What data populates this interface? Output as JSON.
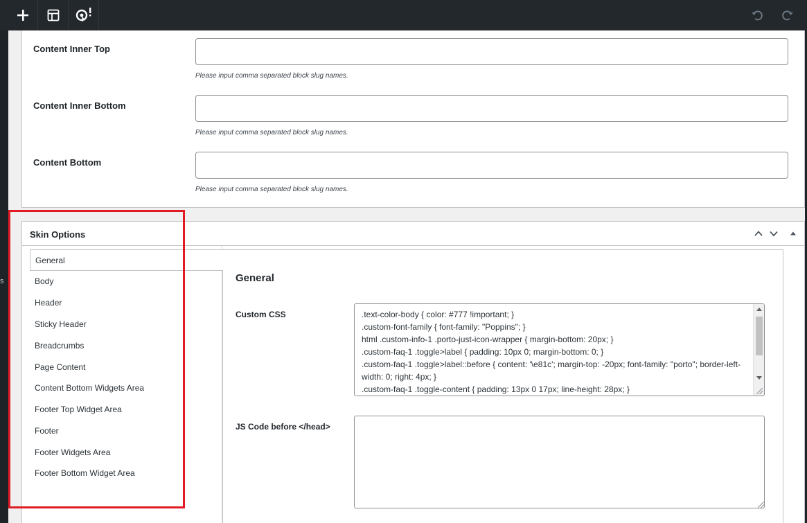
{
  "toolbar": {
    "add_icon": "plus-icon",
    "layout_icon": "layout-icon",
    "insights_icon": "insights-alert-icon",
    "undo_icon": "undo-icon",
    "redo_icon": "redo-icon"
  },
  "left_strip": {
    "glyph": "s"
  },
  "content_fields": [
    {
      "label": "Content Inner Top",
      "value": "",
      "description": "Please input comma separated block slug names."
    },
    {
      "label": "Content Inner Bottom",
      "value": "",
      "description": "Please input comma separated block slug names."
    },
    {
      "label": "Content Bottom",
      "value": "",
      "description": "Please input comma separated block slug names."
    }
  ],
  "skin_options": {
    "title": "Skin Options",
    "tabs": [
      {
        "label": "General",
        "active": true
      },
      {
        "label": "Body"
      },
      {
        "label": "Header"
      },
      {
        "label": "Sticky Header"
      },
      {
        "label": "Breadcrumbs"
      },
      {
        "label": "Page Content"
      },
      {
        "label": "Content Bottom Widgets Area"
      },
      {
        "label": "Footer Top Widget Area"
      },
      {
        "label": "Footer"
      },
      {
        "label": "Footer Widgets Area"
      },
      {
        "label": "Footer Bottom Widget Area"
      }
    ],
    "panel": {
      "title": "General",
      "custom_css_label": "Custom CSS",
      "custom_css_value": ".text-color-body { color: #777 !important; }\n.custom-font-family { font-family: \"Poppins\"; }\nhtml .custom-info-1 .porto-just-icon-wrapper { margin-bottom: 20px; }\n.custom-faq-1 .toggle>label { padding: 10px 0; margin-bottom: 0; }\n.custom-faq-1 .toggle>label::before { content: '\\e81c'; margin-top: -20px; font-family: \"porto\"; border-left-width: 0; right: 4px; }\n.custom-faq-1 .toggle-content { padding: 13px 0 17px; line-height: 28px; }",
      "js_label": "JS Code before </head>",
      "js_value": ""
    }
  },
  "colors": {
    "toolbar_bg": "#23282d",
    "highlight": "#e01b24"
  }
}
